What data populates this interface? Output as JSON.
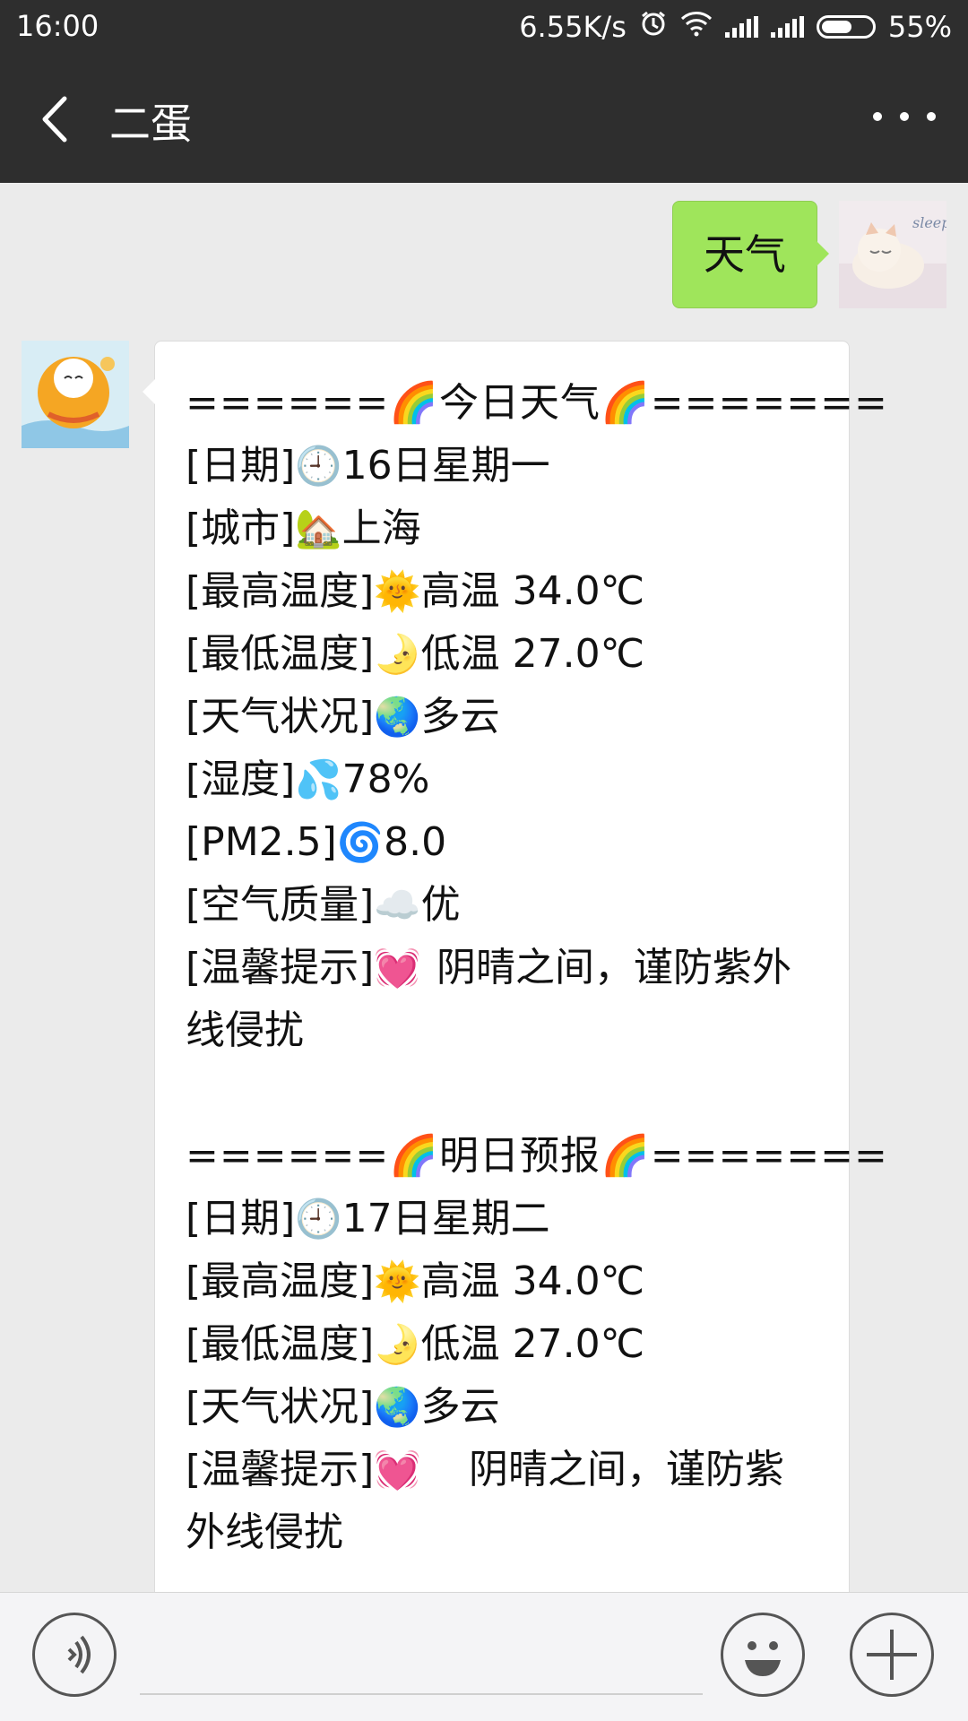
{
  "status_bar": {
    "time": "16:00",
    "network_speed": "6.55K/s",
    "battery": "55%",
    "icons": [
      "alarm-icon",
      "wifi-icon",
      "signal-icon",
      "signal-icon",
      "battery-icon"
    ]
  },
  "header": {
    "title": "二蛋"
  },
  "messages": {
    "outgoing_text": "天气",
    "incoming": {
      "today_header": "======🌈今日天气🌈=======",
      "today": [
        {
          "key": "[日期]",
          "emoji": "🕘",
          "value": "16日星期一"
        },
        {
          "key": "[城市]",
          "emoji": "🏡",
          "value": "上海"
        },
        {
          "key": "[最高温度]",
          "emoji": "🌞",
          "value": "高温 34.0℃"
        },
        {
          "key": "[最低温度]",
          "emoji": "🌛",
          "value": "低温 27.0℃"
        },
        {
          "key": "[天气状况]",
          "emoji": "🌏",
          "value": "多云"
        },
        {
          "key": "[湿度]",
          "emoji": "💦",
          "value": "78%"
        },
        {
          "key": "[PM2.5]",
          "emoji": "🌀",
          "value": "8.0"
        },
        {
          "key": "[空气质量]",
          "emoji": "☁️",
          "value": "优"
        }
      ],
      "today_tip_key": "[温馨提示]",
      "today_tip_emoji": "💓",
      "today_tip": "阴晴之间，谨防紫外线侵扰",
      "tomorrow_header": "======🌈明日预报🌈=======",
      "tomorrow": [
        {
          "key": "[日期]",
          "emoji": "🕘",
          "value": "17日星期二"
        },
        {
          "key": "[最高温度]",
          "emoji": "🌞",
          "value": "高温 34.0℃"
        },
        {
          "key": "[最低温度]",
          "emoji": "🌛",
          "value": "低温 27.0℃"
        },
        {
          "key": "[天气状况]",
          "emoji": "🌏",
          "value": "多云"
        }
      ],
      "tomorrow_tip_key": "[温馨提示]",
      "tomorrow_tip_emoji": "💓",
      "tomorrow_tip": "阴晴之间，谨防紫外线侵扰"
    }
  },
  "input_bar": {
    "placeholder": "",
    "icons": [
      "voice-icon",
      "emoji-icon",
      "plus-icon"
    ]
  },
  "colors": {
    "bar": "#2e2e2e",
    "chat_bg": "#ebebeb",
    "my_bubble": "#9fe55b"
  }
}
